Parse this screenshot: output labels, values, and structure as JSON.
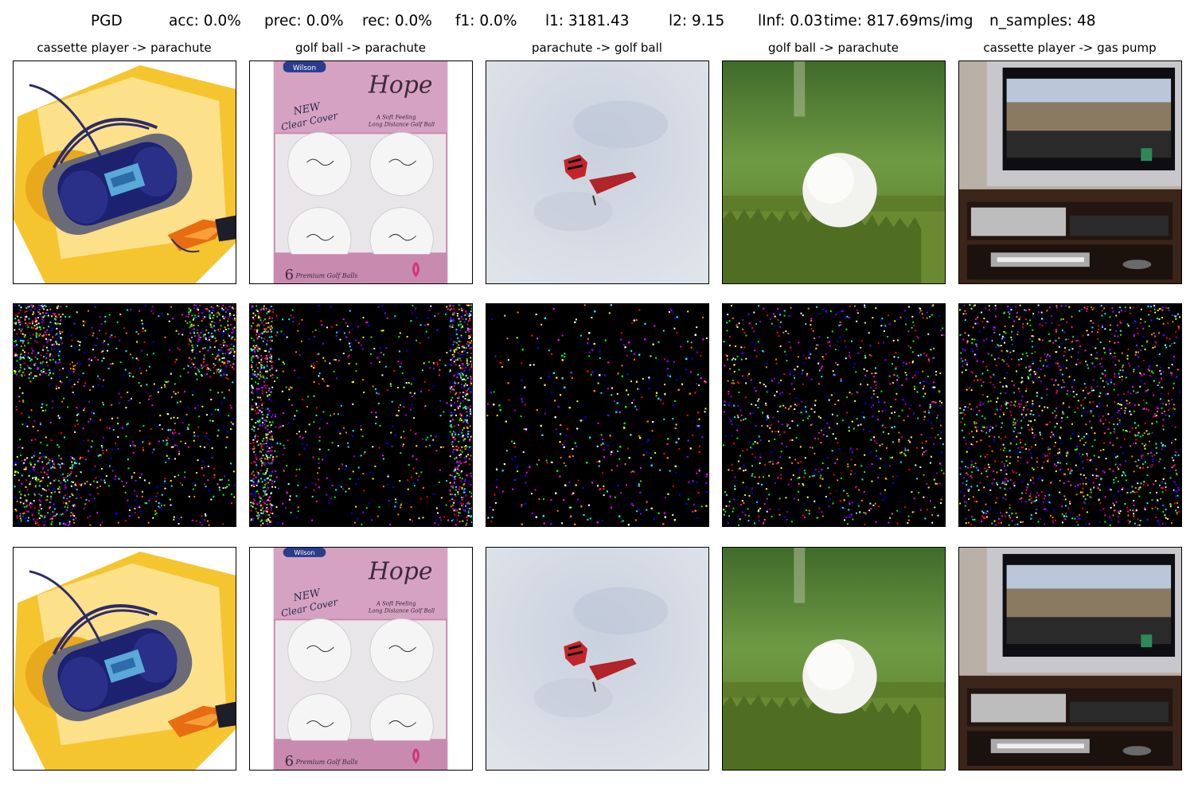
{
  "header": {
    "method": "PGD",
    "acc": "acc: 0.0%",
    "prec": "prec: 0.0%",
    "rec": "rec: 0.0%",
    "f1": "f1: 0.0%",
    "l1": "l1: 3181.43",
    "l2": "l2: 9.15",
    "linf": "lInf: 0.03",
    "time": "time: 817.69ms/img",
    "n_samples": "n_samples: 48"
  },
  "columns": [
    {
      "title": "cassette player -> parachute",
      "image": "boombox-illustration"
    },
    {
      "title": "golf ball -> parachute",
      "image": "golf-ball-box"
    },
    {
      "title": "parachute -> golf ball",
      "image": "parachute-in-sky"
    },
    {
      "title": "golf ball -> parachute",
      "image": "golf-ball-on-grass"
    },
    {
      "title": "cassette player -> gas pump",
      "image": "tv-and-stereo-cabinet"
    }
  ],
  "box_text": {
    "brand": "Wilson",
    "script": "Hope",
    "line1": "NEW",
    "line2": "Clear Cover",
    "tag1": "A Soft Feeling",
    "tag2": "Long Distance Golf Ball",
    "count": "6",
    "footer": "Premium Golf Balls"
  }
}
